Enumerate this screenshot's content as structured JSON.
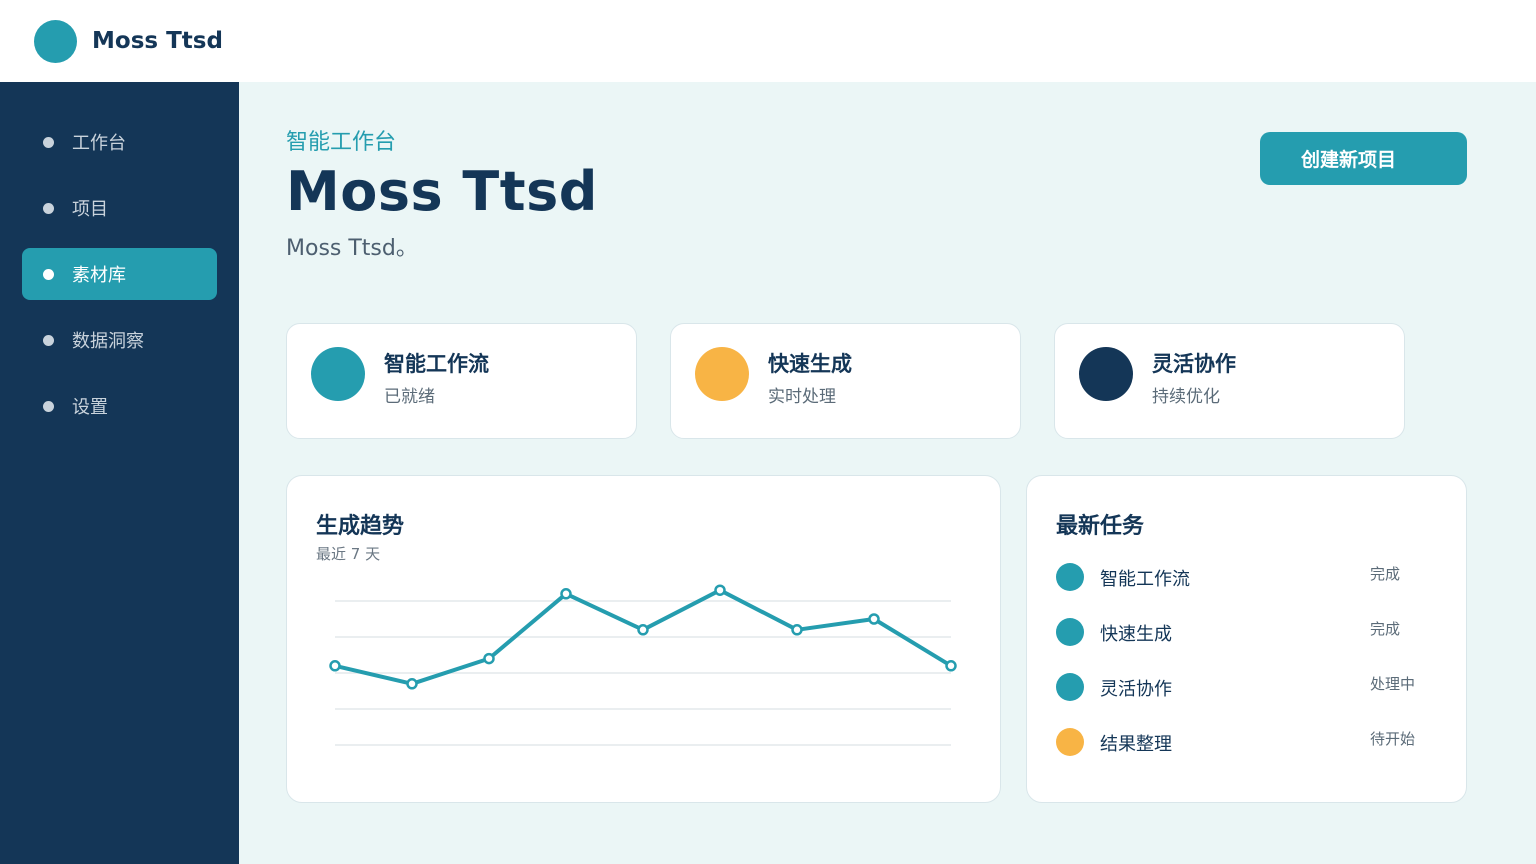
{
  "brand": {
    "name": "Moss Ttsd",
    "logo_color": "#259daf"
  },
  "sidebar": {
    "items": [
      {
        "label": "工作台",
        "active": false
      },
      {
        "label": "项目",
        "active": false
      },
      {
        "label": "素材库",
        "active": true
      },
      {
        "label": "数据洞察",
        "active": false
      },
      {
        "label": "设置",
        "active": false
      }
    ]
  },
  "header": {
    "eyebrow": "智能工作台",
    "title": "Moss Ttsd",
    "subtitle": "Moss Ttsd。",
    "create_button": "创建新项目"
  },
  "features": [
    {
      "title": "智能工作流",
      "subtitle": "已就绪",
      "color": "#259daf"
    },
    {
      "title": "快速生成",
      "subtitle": "实时处理",
      "color": "#f8b445"
    },
    {
      "title": "灵活协作",
      "subtitle": "持续优化",
      "color": "#143657"
    }
  ],
  "trend": {
    "title": "生成趋势",
    "subtitle": "最近 7 天"
  },
  "chart_data": {
    "type": "line",
    "title": "生成趋势",
    "x": [
      1,
      2,
      3,
      4,
      5,
      6,
      7,
      8,
      9
    ],
    "values": [
      42,
      37,
      44,
      62,
      52,
      63,
      52,
      55,
      42
    ],
    "ylim": [
      20,
      60
    ],
    "grid": true,
    "line_color": "#259daf"
  },
  "tasks": {
    "title": "最新任务",
    "items": [
      {
        "name": "智能工作流",
        "status": "完成",
        "color": "#259daf"
      },
      {
        "name": "快速生成",
        "status": "完成",
        "color": "#259daf"
      },
      {
        "name": "灵活协作",
        "status": "处理中",
        "color": "#259daf"
      },
      {
        "name": "结果整理",
        "status": "待开始",
        "color": "#f8b445"
      }
    ]
  }
}
